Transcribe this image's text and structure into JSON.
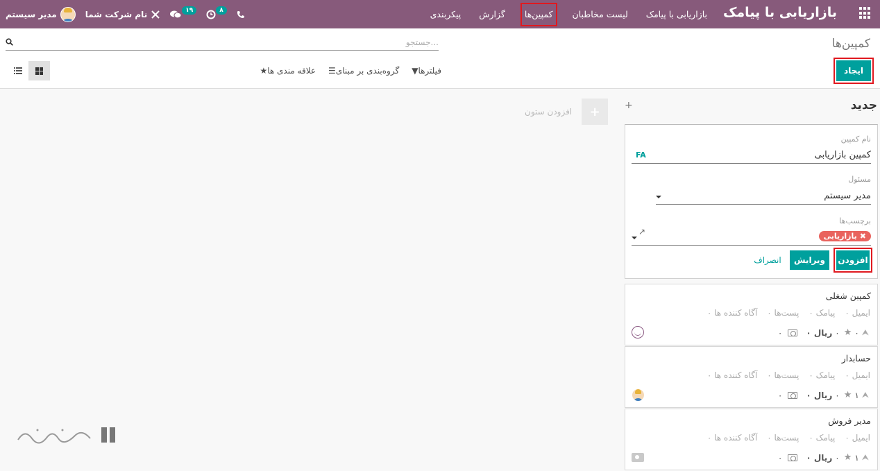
{
  "navbar": {
    "brand": "بازاریابی با پیامک",
    "menu": [
      {
        "label": "بازاریابی با پیامک"
      },
      {
        "label": "لیست مخاطبان"
      },
      {
        "label": "کمپین‌ها",
        "highlighted": true
      },
      {
        "label": "گزارش"
      },
      {
        "label": "پیکربندی"
      }
    ],
    "user_name": "مدیر سیستم",
    "company_name": "نام شرکت شما",
    "messages_count": "۱۹",
    "activities_count": "۸",
    "accent_color": "#875a7b"
  },
  "control_panel": {
    "title": "کمپین‌ها",
    "search_placeholder": "جستجو...",
    "create_label": "ایجاد",
    "filters_label": "فیلترها",
    "groupby_label": "گروه‌بندی بر مبنای",
    "favorites_label": "علاقه مندی ها",
    "views": [
      "kanban-view",
      "list-view"
    ]
  },
  "kanban": {
    "column_title": "جدید",
    "add_column_label": "افزودن ستون",
    "quick_create": {
      "name_label": "نام کمپین",
      "name_value": "کمپین بازاریابی",
      "lang_badge": "FA",
      "responsible_label": "مسئول",
      "responsible_value": "مدیر سیستم",
      "tags_label": "برچسب‌ها",
      "tag": "بازاریابی",
      "add_label": "افزودن",
      "edit_label": "ویرایش",
      "cancel_label": "انصراف"
    },
    "cards": [
      {
        "title": "کمپین شغلی",
        "stats": [
          "۰ ایمیل",
          "۰ پیامک",
          "۰ پست‌ها",
          "۰ آگاه کننده ها"
        ],
        "clicks": "۰",
        "favorites": "۰",
        "revenue": "۰",
        "currency": "ریال",
        "money": "۰",
        "avatar": "smile-icon"
      },
      {
        "title": "حسابدار",
        "stats": [
          "۰ ایمیل",
          "۰ پیامک",
          "۰ پست‌ها",
          "۰ آگاه کننده ها"
        ],
        "clicks": "۱",
        "favorites": "۰",
        "revenue": "۰",
        "currency": "ریال",
        "money": "۰",
        "avatar": "user-avatar"
      },
      {
        "title": "مدیر فروش",
        "stats": [
          "۰ ایمیل",
          "۰ پیامک",
          "۰ پست‌ها",
          "۰ آگاه کننده ها"
        ],
        "clicks": "۱",
        "favorites": "۰",
        "revenue": "۰",
        "currency": "ریال",
        "money": "۰",
        "avatar": "camera-icon"
      }
    ]
  },
  "colors": {
    "primary": "#00a09d",
    "highlight": "#e0191f",
    "tag": "#e9635e"
  }
}
